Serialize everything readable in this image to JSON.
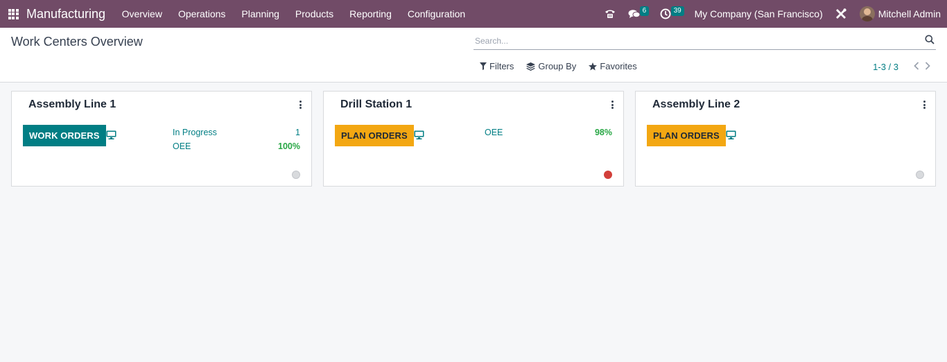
{
  "navbar": {
    "app_name": "Manufacturing",
    "menu": [
      "Overview",
      "Operations",
      "Planning",
      "Products",
      "Reporting",
      "Configuration"
    ],
    "messages_count": "6",
    "activities_count": "39",
    "company": "My Company (San Francisco)",
    "user": "Mitchell Admin"
  },
  "control_panel": {
    "title": "Work Centers Overview",
    "search_placeholder": "Search...",
    "filters_label": "Filters",
    "group_by_label": "Group By",
    "favorites_label": "Favorites",
    "pager": "1-3 / 3"
  },
  "cards": [
    {
      "name": "Assembly Line 1",
      "button": "WORK ORDERS",
      "stats": [
        {
          "label": "In Progress",
          "value": "1"
        },
        {
          "label": "OEE",
          "value": "100%"
        }
      ],
      "status": "grey"
    },
    {
      "name": "Drill Station 1",
      "button": "PLAN ORDERS",
      "stats": [
        {
          "label": "OEE",
          "value": "98%"
        }
      ],
      "status": "red"
    },
    {
      "name": "Assembly Line 2",
      "button": "PLAN ORDERS",
      "stats": [],
      "status": "grey"
    }
  ],
  "colors": {
    "navbar": "#714b67",
    "teal": "#017e84",
    "amber": "#f3a712",
    "green_value": "#28a745",
    "blocked_red": "#d23f3a"
  }
}
